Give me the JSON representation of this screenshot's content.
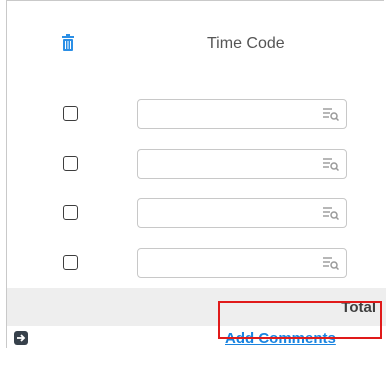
{
  "header": {
    "title": "Time Code",
    "delete_icon": "trash-icon"
  },
  "rows": [
    {
      "checked": false,
      "value": ""
    },
    {
      "checked": false,
      "value": ""
    },
    {
      "checked": false,
      "value": ""
    },
    {
      "checked": false,
      "value": ""
    }
  ],
  "total": {
    "label": "Total"
  },
  "footer": {
    "expand_icon": "arrow-right-icon",
    "add_comments_label": "Add Comments"
  },
  "colors": {
    "accent": "#1a84e0",
    "highlight": "#e01a1a"
  }
}
